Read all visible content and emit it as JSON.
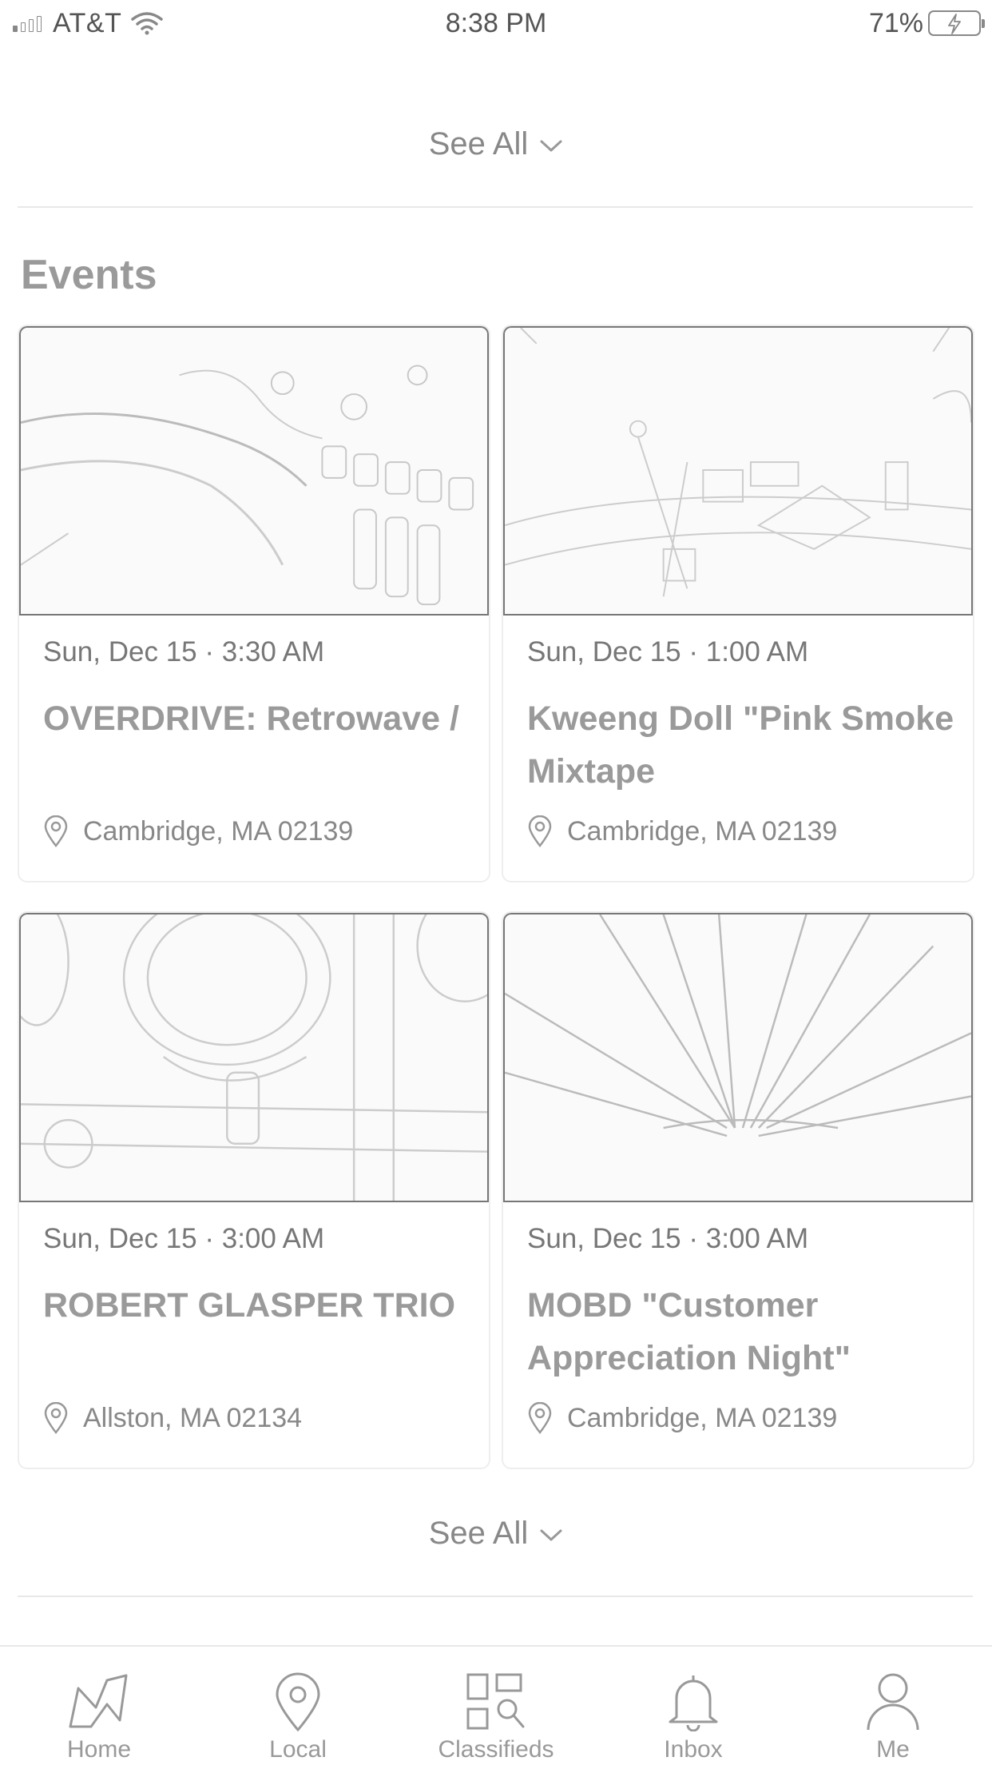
{
  "status_bar": {
    "carrier": "AT&T",
    "time": "8:38 PM",
    "battery": "71%"
  },
  "see_all_top": {
    "label": "See All"
  },
  "events": {
    "title": "Events",
    "cards": [
      {
        "date": "Sun, Dec 15 · 3:30 AM",
        "title": "OVERDRIVE: Retrowave /",
        "location": "Cambridge, MA 02139"
      },
      {
        "date": "Sun, Dec 15 · 1:00 AM",
        "title": "Kweeng Doll \"Pink Smoke Mixtape",
        "location": "Cambridge, MA 02139"
      },
      {
        "date": "Sun, Dec 15 · 3:00 AM",
        "title": "ROBERT GLASPER TRIO",
        "location": "Allston, MA 02134"
      },
      {
        "date": "Sun, Dec 15 · 3:00 AM",
        "title": "MOBD \"Customer Appreciation Night\"",
        "location": "Cambridge, MA 02139"
      }
    ],
    "see_all": "See All"
  },
  "tab_bar": {
    "tabs": [
      {
        "label": "Home",
        "icon": "home-map-icon"
      },
      {
        "label": "Local",
        "icon": "location-pin-icon"
      },
      {
        "label": "Classifieds",
        "icon": "classifieds-grid-icon"
      },
      {
        "label": "Inbox",
        "icon": "bell-icon"
      },
      {
        "label": "Me",
        "icon": "person-icon"
      }
    ]
  }
}
